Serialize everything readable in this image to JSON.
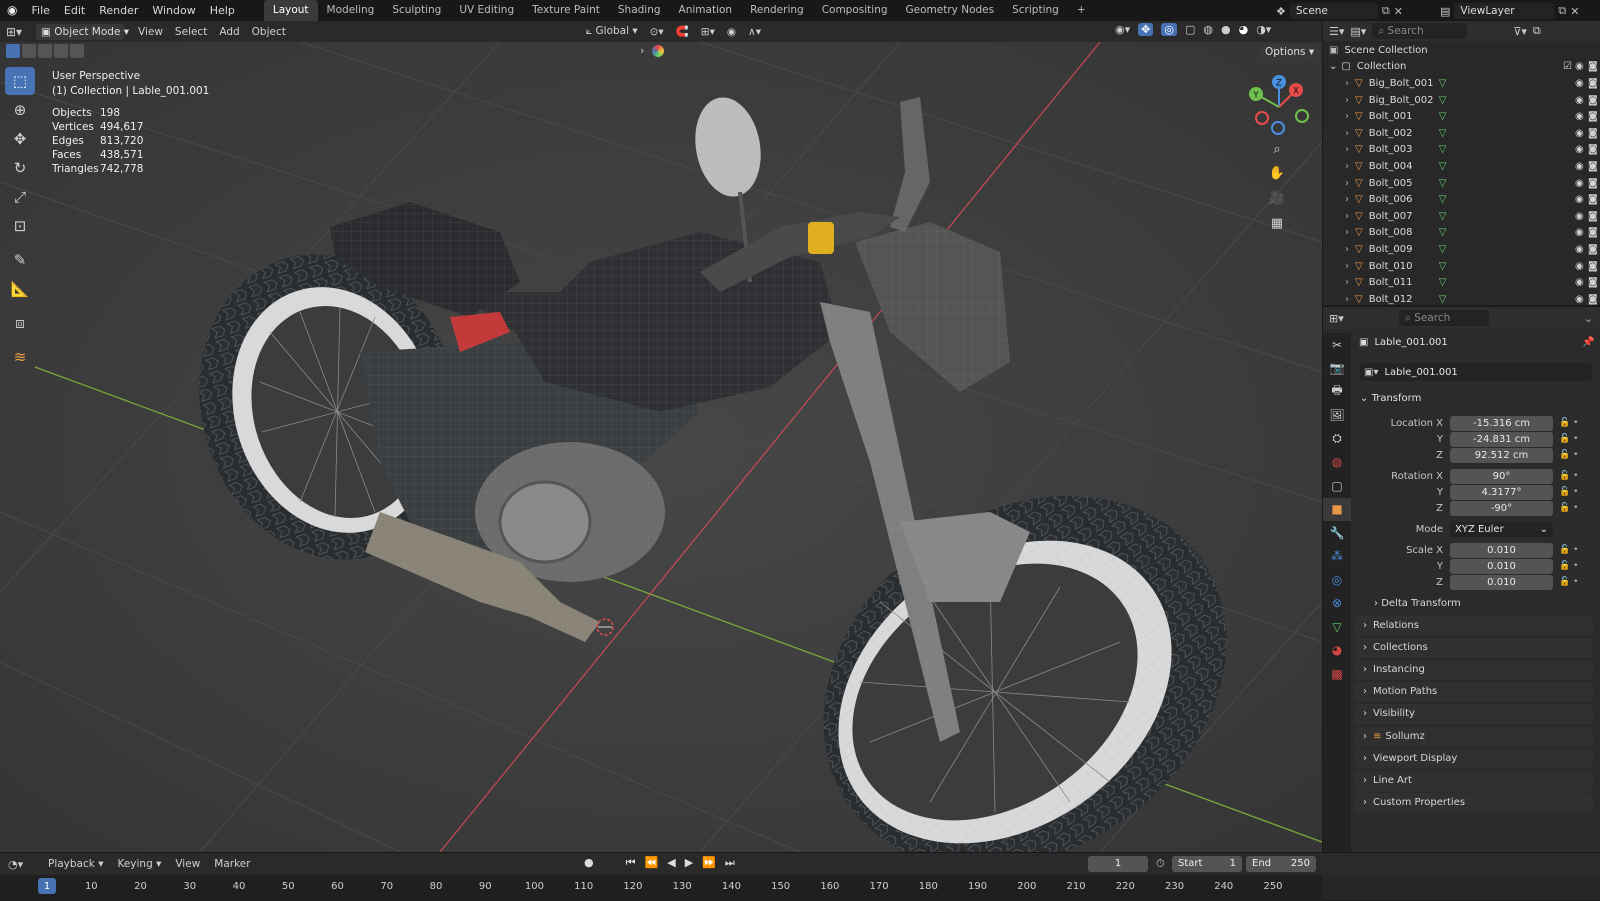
{
  "menus": [
    "File",
    "Edit",
    "Render",
    "Window",
    "Help"
  ],
  "workspace_tabs": [
    "Layout",
    "Modeling",
    "Sculpting",
    "UV Editing",
    "Texture Paint",
    "Shading",
    "Animation",
    "Rendering",
    "Compositing",
    "Geometry Nodes",
    "Scripting"
  ],
  "active_workspace": "Layout",
  "scene_name": "Scene",
  "view_layer": "ViewLayer",
  "viewport_header": {
    "mode": "Object Mode",
    "menu": [
      "View",
      "Select",
      "Add",
      "Object"
    ],
    "orientation": "Global",
    "options": "Options"
  },
  "overlay": {
    "perspective": "User Perspective",
    "collection_line": "(1) Collection | Lable_001.001",
    "stats": [
      {
        "label": "Objects",
        "value": "198"
      },
      {
        "label": "Vertices",
        "value": "494,617"
      },
      {
        "label": "Edges",
        "value": "813,720"
      },
      {
        "label": "Faces",
        "value": "438,571"
      },
      {
        "label": "Triangles",
        "value": "742,778"
      }
    ]
  },
  "gizmo": {
    "x": "X",
    "y": "Y",
    "z": "Z"
  },
  "outliner": {
    "search_placeholder": "Search",
    "scene_collection": "Scene Collection",
    "collection": "Collection",
    "items": [
      "Big_Bolt_001",
      "Big_Bolt_002",
      "Bolt_001",
      "Bolt_002",
      "Bolt_003",
      "Bolt_004",
      "Bolt_005",
      "Bolt_006",
      "Bolt_007",
      "Bolt_008",
      "Bolt_009",
      "Bolt_010",
      "Bolt_011",
      "Bolt_012"
    ]
  },
  "properties": {
    "search_placeholder": "Search",
    "object_name": "Lable_001.001",
    "object_field": "Lable_001.001",
    "transform_title": "Transform",
    "location": {
      "label": "Location X",
      "x": "-15.316 cm",
      "y": "-24.831 cm",
      "z": "92.512 cm"
    },
    "rotation": {
      "label": "Rotation X",
      "x": "90°",
      "y": "4.3177°",
      "z": "-90°"
    },
    "mode": {
      "label": "Mode",
      "value": "XYZ Euler"
    },
    "scale": {
      "label": "Scale X",
      "x": "0.010",
      "y": "0.010",
      "z": "0.010"
    },
    "axis_y": "Y",
    "axis_z": "Z",
    "delta": "Delta Transform",
    "panels": [
      "Relations",
      "Collections",
      "Instancing",
      "Motion Paths",
      "Visibility",
      "Sollumz",
      "Viewport Display",
      "Line Art",
      "Custom Properties"
    ]
  },
  "timeline": {
    "menus": [
      "Playback",
      "Keying",
      "View",
      "Marker"
    ],
    "current_frame": "1",
    "start_label": "Start",
    "start": "1",
    "end_label": "End",
    "end": "250",
    "ticks": [
      "1",
      "10",
      "20",
      "30",
      "40",
      "50",
      "60",
      "70",
      "80",
      "90",
      "100",
      "110",
      "120",
      "130",
      "140",
      "150",
      "160",
      "170",
      "180",
      "190",
      "200",
      "210",
      "220",
      "230",
      "240",
      "250"
    ]
  },
  "colors": {
    "accent": "#4772b3",
    "mesh_orange": "#e8964a",
    "mesh_green": "#5fd16a",
    "x_axis": "#c94a55",
    "y_axis": "#7aad3a"
  }
}
